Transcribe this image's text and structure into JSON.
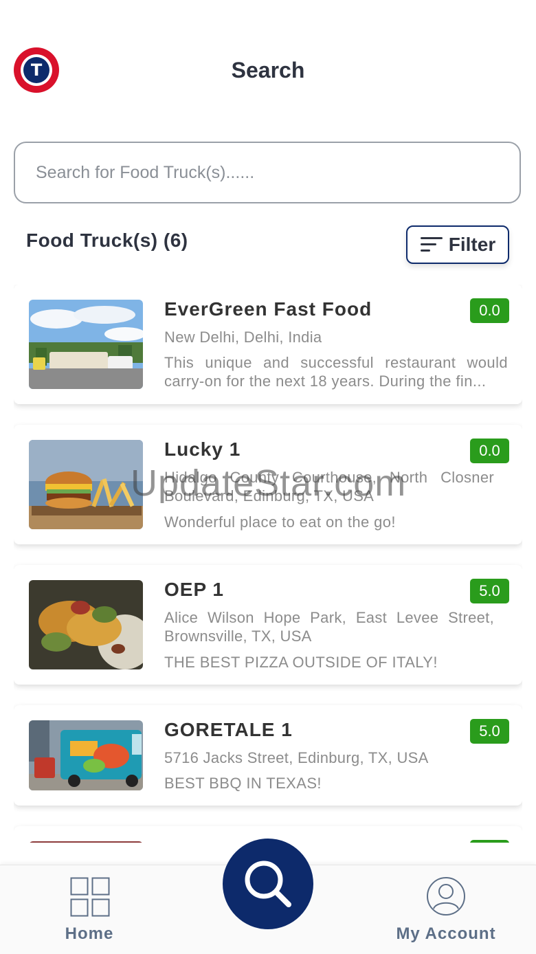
{
  "header": {
    "title": "Search",
    "logo_letter": "T"
  },
  "search": {
    "placeholder": "Search for Food Truck(s)......",
    "value": ""
  },
  "list": {
    "heading": "Food Truck(s) (6)",
    "filter_label": "Filter"
  },
  "trucks": [
    {
      "name": "EverGreen Fast Food",
      "address": "New Delhi, Delhi, India",
      "description": "This unique and successful restaurant would carry-on for the next 18 years. During the fin...",
      "rating": "0.0"
    },
    {
      "name": "Lucky 1",
      "address": "Hidalgo County Courthouse, North Closner Boulevard, Edinburg, TX, USA",
      "description": "Wonderful place to eat on the go!",
      "rating": "0.0"
    },
    {
      "name": "OEP 1",
      "address": "Alice Wilson Hope Park, East Levee Street, Brownsville, TX, USA",
      "description": "THE BEST PIZZA OUTSIDE OF ITALY!",
      "rating": "5.0"
    },
    {
      "name": "GORETALE 1",
      "address": "5716 Jacks Street, Edinburg, TX, USA",
      "description": "BEST BBQ IN TEXAS!",
      "rating": "5.0"
    }
  ],
  "watermark": "UpdateStar.com",
  "bottom_nav": {
    "home_label": "Home",
    "account_label": "My Account"
  },
  "colors": {
    "primary": "#0d2a6b",
    "rating_green": "#2a9c1c",
    "logo_red": "#d9112b",
    "nav_text": "#5d6f87"
  },
  "icons": [
    "logo-icon",
    "filter-icon",
    "grid-icon",
    "search-icon",
    "account-icon"
  ]
}
